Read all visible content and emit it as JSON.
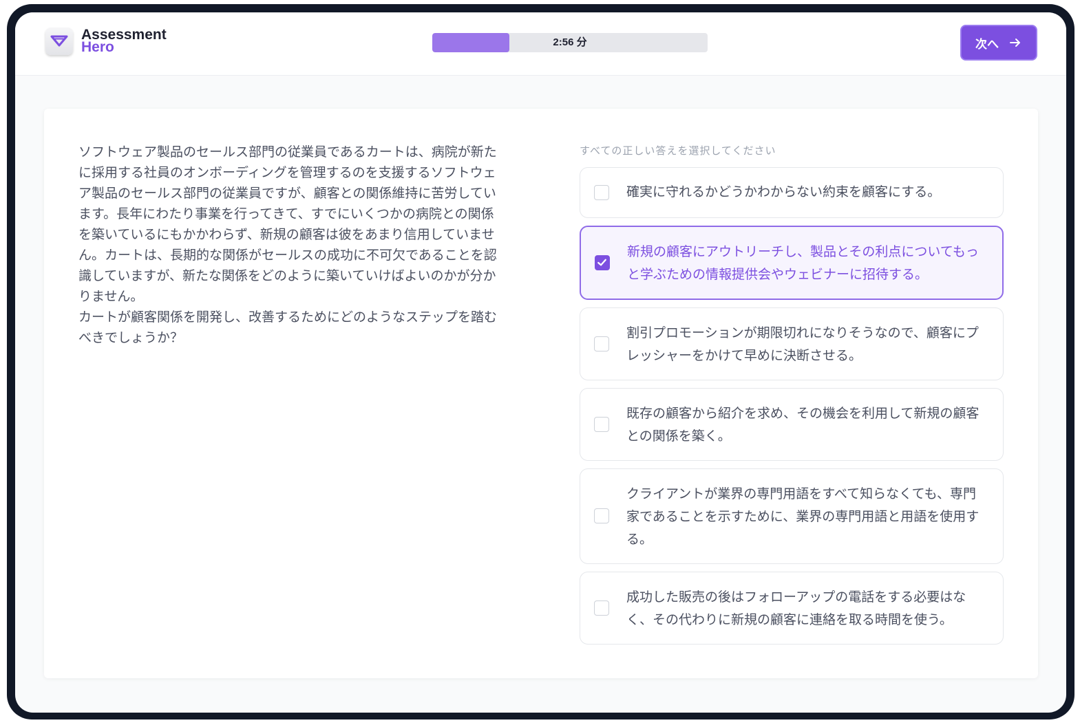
{
  "brand": {
    "line1": "Assessment",
    "line2": "Hero",
    "accent": "#7c4fe0",
    "icon": "logo-heart-icon"
  },
  "timer": {
    "label": "2:56 分",
    "progress": 0.28
  },
  "next_button": {
    "label": "次へ",
    "icon": "arrow-right-icon"
  },
  "question": {
    "text": "ソフトウェア製品のセールス部門の従業員であるカートは、病院が新たに採用する社員のオンボーディングを管理するのを支援するソフトウェア製品のセールス部門の従業員ですが、顧客との関係維持に苦労しています。長年にわたり事業を行ってきて、すでにいくつかの病院との関係を築いているにもかかわらず、新規の顧客は彼をあまり信用していません。カートは、長期的な関係がセールスの成功に不可欠であることを認識していますが、新たな関係をどのように築いていけばよいのかが分かりません。",
    "prompt": "カートが顧客関係を開発し、改善するためにどのようなステップを踏むべきでしょうか？"
  },
  "instruction": "すべての正しい答えを選択してください",
  "options": [
    {
      "text": "確実に守れるかどうかわからない約束を顧客にする。",
      "selected": false
    },
    {
      "text": "新規の顧客にアウトリーチし、製品とその利点についてもっと学ぶための情報提供会やウェビナーに招待する。",
      "selected": true
    },
    {
      "text": "割引プロモーションが期限切れになりそうなので、顧客にプレッシャーをかけて早めに決断させる。",
      "selected": false
    },
    {
      "text": "既存の顧客から紹介を求め、その機会を利用して新規の顧客との関係を築く。",
      "selected": false
    },
    {
      "text": "クライアントが業界の専門用語をすべて知らなくても、専門家であることを示すために、業界の専門用語と用語を使用する。",
      "selected": false
    },
    {
      "text": "成功した販売の後はフォローアップの電話をする必要はなく、その代わりに新規の顧客に連絡を取る時間を使う。",
      "selected": false
    }
  ]
}
